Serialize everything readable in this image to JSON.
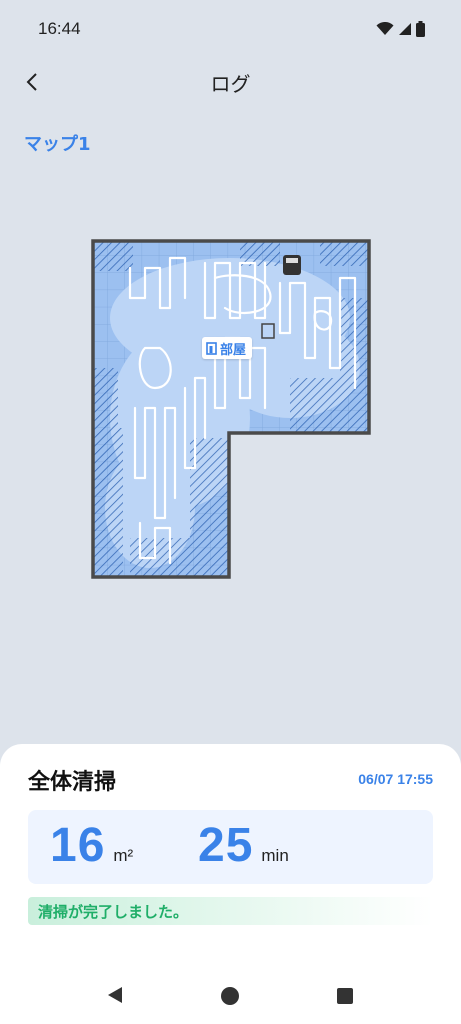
{
  "status_bar": {
    "time": "16:44"
  },
  "header": {
    "title": "ログ"
  },
  "map": {
    "name": "マップ1",
    "room_label": "部屋"
  },
  "summary": {
    "title": "全体清掃",
    "datetime": "06/07 17:55",
    "area_value": "16",
    "area_unit": "m²",
    "time_value": "25",
    "time_unit": "min",
    "status_message": "清掃が完了しました。"
  },
  "colors": {
    "accent": "#3a82e8",
    "success": "#1fae68",
    "map_fill": "#9cc0f0",
    "map_border": "#4a4a4a",
    "background": "#dde3eb"
  }
}
